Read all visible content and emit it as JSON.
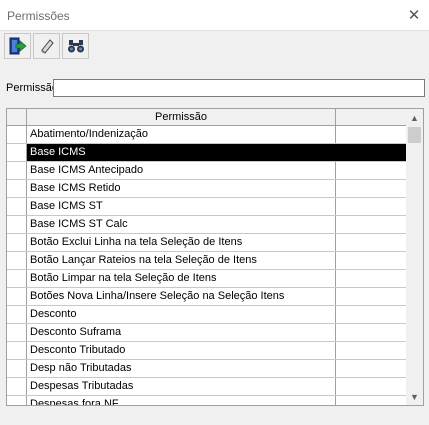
{
  "window": {
    "title": "Permissões",
    "close_glyph": "✕"
  },
  "toolbar": {
    "buttons": [
      {
        "icon": "exit-door-icon"
      },
      {
        "icon": "eraser-icon"
      },
      {
        "icon": "binoculars-icon"
      }
    ]
  },
  "filter": {
    "label": "Permissão",
    "value": "",
    "placeholder": ""
  },
  "grid": {
    "column_header": "Permissão",
    "selected_index": 1,
    "rows": [
      "Abatimento/Indenização",
      "Base ICMS",
      "Base ICMS Antecipado",
      "Base ICMS Retido",
      "Base ICMS ST",
      "Base ICMS ST Calc",
      "Botão Exclui Linha na tela Seleção de Itens",
      "Botão Lançar Rateios na tela Seleção de Itens",
      "Botão Limpar na tela Seleção de Itens",
      "Botões Nova Linha/Insere Seleção na Seleção Itens",
      "Desconto",
      "Desconto Suframa",
      "Desconto Tributado",
      "Desp não Tributadas",
      "Despesas Tributadas",
      "Despesas fora NF"
    ]
  },
  "colors": {
    "selection_bg": "#000000",
    "selection_fg": "#ffffff",
    "window_bg": "#f0f0f0"
  }
}
